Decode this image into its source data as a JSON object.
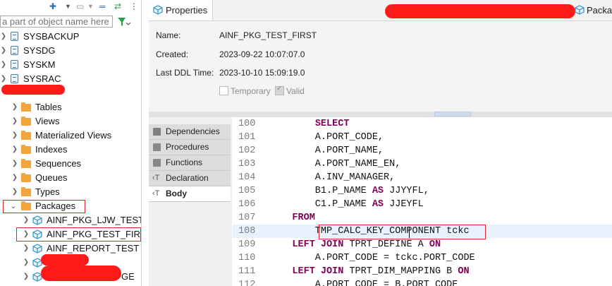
{
  "left_panel": {
    "search_placeholder": "a part of object name here",
    "tree": [
      {
        "label": "SYSBACKUP",
        "type": "schema"
      },
      {
        "label": "SYSDG",
        "type": "schema"
      },
      {
        "label": "SYSKM",
        "type": "schema"
      },
      {
        "label": "SYSRAC",
        "type": "schema"
      },
      {
        "label": "Tables",
        "type": "folder"
      },
      {
        "label": "Views",
        "type": "folder"
      },
      {
        "label": "Materialized Views",
        "type": "folder"
      },
      {
        "label": "Indexes",
        "type": "folder"
      },
      {
        "label": "Sequences",
        "type": "folder"
      },
      {
        "label": "Queues",
        "type": "folder"
      },
      {
        "label": "Types",
        "type": "folder"
      },
      {
        "label": "Packages",
        "type": "folder"
      },
      {
        "label": "AINF_PKG_LJW_TEST_",
        "type": "package"
      },
      {
        "label": "AINF_PKG_TEST_FIRST",
        "type": "package"
      },
      {
        "label": "AINF_REPORT_TEST",
        "type": "package"
      },
      {
        "label": "GE",
        "type": "package"
      }
    ]
  },
  "tabs": {
    "properties": "Properties",
    "package": "Packag"
  },
  "properties": {
    "name_label": "Name:",
    "name_value": "AINF_PKG_TEST_FIRST",
    "created_label": "Created:",
    "created_value": "2023-09-22 10:07:07.0",
    "ddl_label": "Last DDL Time:",
    "ddl_value": "2023-10-10 15:09:19.0",
    "temporary_label": "Temporary",
    "valid_label": "Valid"
  },
  "side_tabs": [
    "Dependencies",
    "Procedures",
    "Functions",
    "Declaration",
    "Body"
  ],
  "code": {
    "lines": [
      {
        "n": "100",
        "segs": [
          {
            "t": "        "
          },
          {
            "t": "SELECT",
            "k": 1
          }
        ]
      },
      {
        "n": "101",
        "segs": [
          {
            "t": "        A.PORT_CODE,"
          }
        ]
      },
      {
        "n": "102",
        "segs": [
          {
            "t": "        A.PORT_NAME,"
          }
        ]
      },
      {
        "n": "103",
        "segs": [
          {
            "t": "        A.PORT_NAME_EN,"
          }
        ]
      },
      {
        "n": "104",
        "segs": [
          {
            "t": "        A.INV_MANAGER,"
          }
        ]
      },
      {
        "n": "105",
        "segs": [
          {
            "t": "        B1.P_NAME "
          },
          {
            "t": "AS",
            "k": 1
          },
          {
            "t": " JJYYFL,"
          }
        ]
      },
      {
        "n": "106",
        "segs": [
          {
            "t": "        C1.P_NAME "
          },
          {
            "t": "AS",
            "k": 1
          },
          {
            "t": " JJEYFL"
          }
        ]
      },
      {
        "n": "107",
        "segs": [
          {
            "t": "    "
          },
          {
            "t": "FROM",
            "k": 1
          }
        ]
      },
      {
        "n": "108",
        "segs": [
          {
            "t": "        TMP_CALC_KEY_COMPONENT tckc"
          }
        ]
      },
      {
        "n": "109",
        "segs": [
          {
            "t": "    "
          },
          {
            "t": "LEFT JOIN",
            "k": 1
          },
          {
            "t": " TPRT_DEFINE A "
          },
          {
            "t": "ON",
            "k": 1
          }
        ]
      },
      {
        "n": "110",
        "segs": [
          {
            "t": "        A.PORT_CODE = tckc.PORT_CODE"
          }
        ]
      },
      {
        "n": "111",
        "segs": [
          {
            "t": "    "
          },
          {
            "t": "LEFT JOIN",
            "k": 1
          },
          {
            "t": " TPRT_DIM_MAPPING B "
          },
          {
            "t": "ON",
            "k": 1
          }
        ]
      },
      {
        "n": "112",
        "segs": [
          {
            "t": "        A.PORT_CODE = B.PORT_CODE"
          }
        ]
      }
    ]
  }
}
